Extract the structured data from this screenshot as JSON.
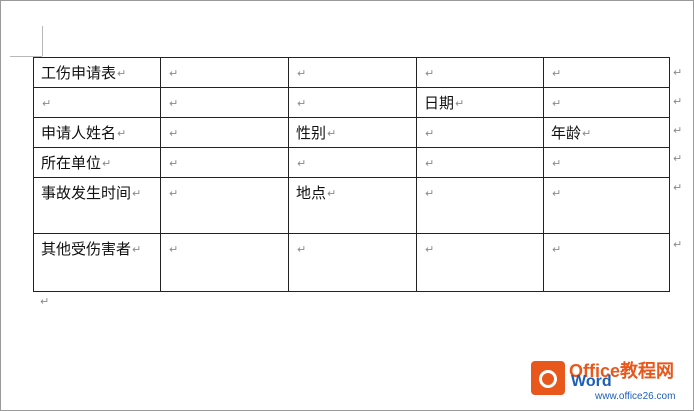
{
  "mark": "↵",
  "table": {
    "rows": [
      [
        "工伤申请表",
        "",
        "",
        "",
        ""
      ],
      [
        "",
        "",
        "",
        "日期",
        ""
      ],
      [
        "申请人姓名",
        "",
        "性别",
        "",
        "年龄"
      ],
      [
        "所在单位",
        "",
        "",
        "",
        ""
      ],
      [
        "事故发生时间",
        "",
        "地点",
        "",
        ""
      ],
      [
        "其他受伤害者",
        "",
        "",
        "",
        ""
      ]
    ]
  },
  "watermark": {
    "title": "Office教程网",
    "product": "Word",
    "url": "www.office26.com"
  },
  "colors": {
    "brand_orange": "#e8581c",
    "brand_blue": "#1d5fb6"
  }
}
